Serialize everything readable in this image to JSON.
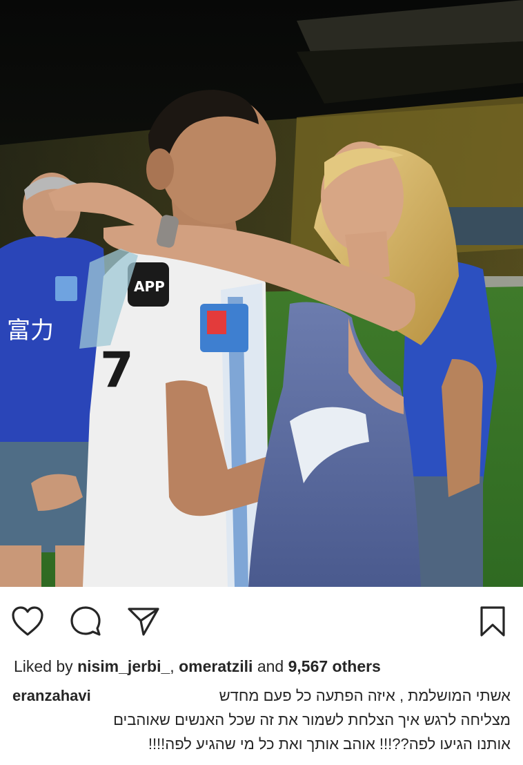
{
  "post": {
    "photo": {
      "description_icon": "photo",
      "jersey_sponsor_badge": "APP",
      "fan_shirt_text": "富力",
      "jersey_number": "7"
    },
    "actions": {
      "like_icon": "heart-icon",
      "comment_icon": "comment-icon",
      "share_icon": "paper-plane-icon",
      "save_icon": "bookmark-icon"
    },
    "likes": {
      "prefix": "Liked by",
      "user1": "nisim_jerbi_",
      "separator": ",",
      "user2": "omeratzili",
      "middle": "and",
      "count": "9,567 others"
    },
    "caption": {
      "author": "eranzahavi",
      "line1": "אשתי המושלמת , איזה הפתעה כל פעם מחדש",
      "line2": "מצליחה לרגש איך הצלחת לשמור את זה שכל האנשים שאוהבים",
      "line3": "אותנו הגיעו לפה??!!! אוהב אותך ואת כל מי שהגיע לפה!!!!"
    }
  }
}
